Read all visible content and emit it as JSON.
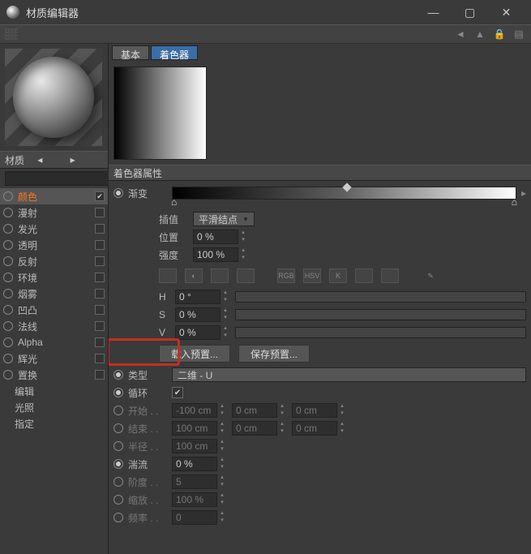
{
  "window": {
    "title": "材质编辑器"
  },
  "material_name": "材质",
  "channels": [
    {
      "name": "颜色",
      "checked": true,
      "selected": true
    },
    {
      "name": "漫射",
      "checked": false
    },
    {
      "name": "发光",
      "checked": false
    },
    {
      "name": "透明",
      "checked": false
    },
    {
      "name": "反射",
      "checked": false
    },
    {
      "name": "环境",
      "checked": false
    },
    {
      "name": "烟雾",
      "checked": false
    },
    {
      "name": "凹凸",
      "checked": false
    },
    {
      "name": "法线",
      "checked": false
    },
    {
      "name": "Alpha",
      "checked": false
    },
    {
      "name": "辉光",
      "checked": false
    },
    {
      "name": "置换",
      "checked": false
    }
  ],
  "sub_channels": [
    "编辑",
    "光照",
    "指定"
  ],
  "tabs": {
    "basic": "基本",
    "shader": "着色器"
  },
  "section": "着色器属性",
  "gradient_label": "渐变",
  "interp": {
    "label": "插值",
    "value": "平滑结点"
  },
  "position": {
    "label": "位置",
    "value": "0 %"
  },
  "intensity": {
    "label": "强度",
    "value": "100 %"
  },
  "hsv": {
    "h": {
      "label": "H",
      "value": "0 °"
    },
    "s": {
      "label": "S",
      "value": "0 %"
    },
    "v": {
      "label": "V",
      "value": "0 %"
    }
  },
  "icons": {
    "rgb": "RGB",
    "hsv": "HSV",
    "k": "K"
  },
  "buttons": {
    "load_preset": "载入预置...",
    "save_preset": "保存预置..."
  },
  "type": {
    "label": "类型",
    "value": "二维 - U"
  },
  "cycle": {
    "label": "循环"
  },
  "start": {
    "label": "开始 . .",
    "v1": "-100 cm",
    "v2": "0 cm",
    "v3": "0 cm"
  },
  "end": {
    "label": "结束 . .",
    "v1": "100 cm",
    "v2": "0 cm",
    "v3": "0 cm"
  },
  "radius": {
    "label": "半径 . .",
    "v1": "100 cm"
  },
  "turb": {
    "label": "湍流",
    "value": "0 %"
  },
  "octave": {
    "label": "阶度 . .",
    "value": "5"
  },
  "scale": {
    "label": "缩放 . .",
    "value": "100 %"
  },
  "freq": {
    "label": "频率 . .",
    "value": "0"
  }
}
